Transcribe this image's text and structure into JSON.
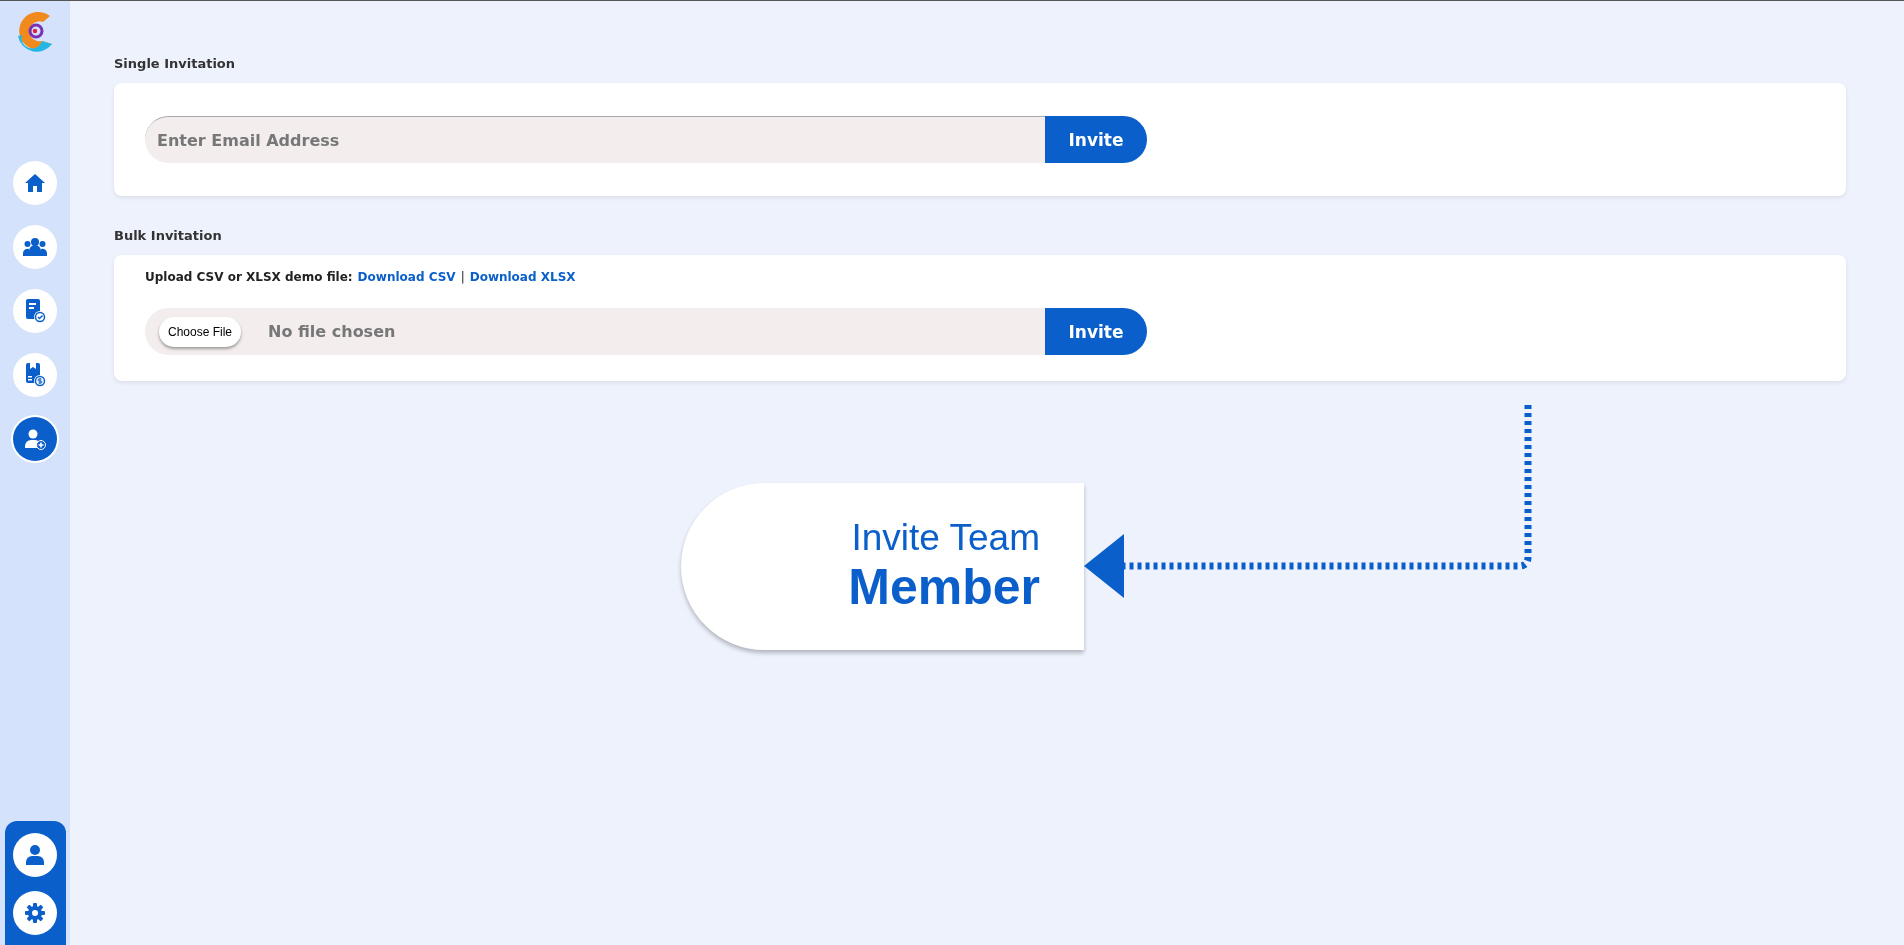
{
  "sidebar": {
    "nav_items": [
      {
        "kind": "home",
        "selected": false
      },
      {
        "kind": "team",
        "selected": false
      },
      {
        "kind": "report",
        "selected": false
      },
      {
        "kind": "billing",
        "selected": false
      },
      {
        "kind": "invite",
        "selected": true
      }
    ],
    "bottom_items": [
      {
        "kind": "profile"
      },
      {
        "kind": "settings"
      }
    ]
  },
  "single_invitation": {
    "title": "Single Invitation",
    "email_field": {
      "placeholder": "Enter Email Address"
    },
    "button": "Invite"
  },
  "bulk_invitation": {
    "title": "Bulk Invitation",
    "upload_text": "Upload CSV or XLSX demo file:",
    "links": [
      "Download CSV",
      "Download XLSX"
    ],
    "separator": "|",
    "choose_file": "Choose File",
    "file_status": "No file chosen",
    "button": "Invite"
  },
  "callout": {
    "line_1": "Invite Team",
    "line_2": "Member"
  }
}
